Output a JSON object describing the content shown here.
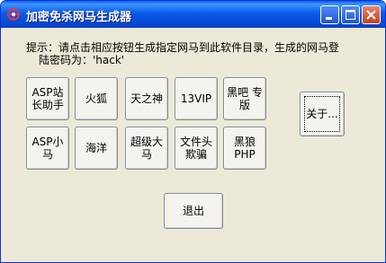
{
  "window": {
    "title": "加密免杀网马生成器"
  },
  "hint": {
    "line1": "提示：请点击相应按钮生成指定网马到此软件目录，生成的网马登",
    "line2": "陆密码为：'hack'"
  },
  "buttons": {
    "asp_station": "ASP站\n长助手",
    "firefox": "火狐",
    "tianzhishen": "天之神",
    "vip13": "13VIP",
    "heiba": "黑吧 专\n版",
    "asp_small": "ASP小\n马",
    "haiyang": "海洋",
    "super_big": "超级大\n马",
    "file_header": "文件头\n欺骗",
    "heilang_php": "黑狼\nPHP",
    "about": "关于...",
    "exit": "退出"
  },
  "colors": {
    "titlebar": "#0a5ce8",
    "window_bg": "#ece9d8",
    "close_button": "#c2411c"
  }
}
